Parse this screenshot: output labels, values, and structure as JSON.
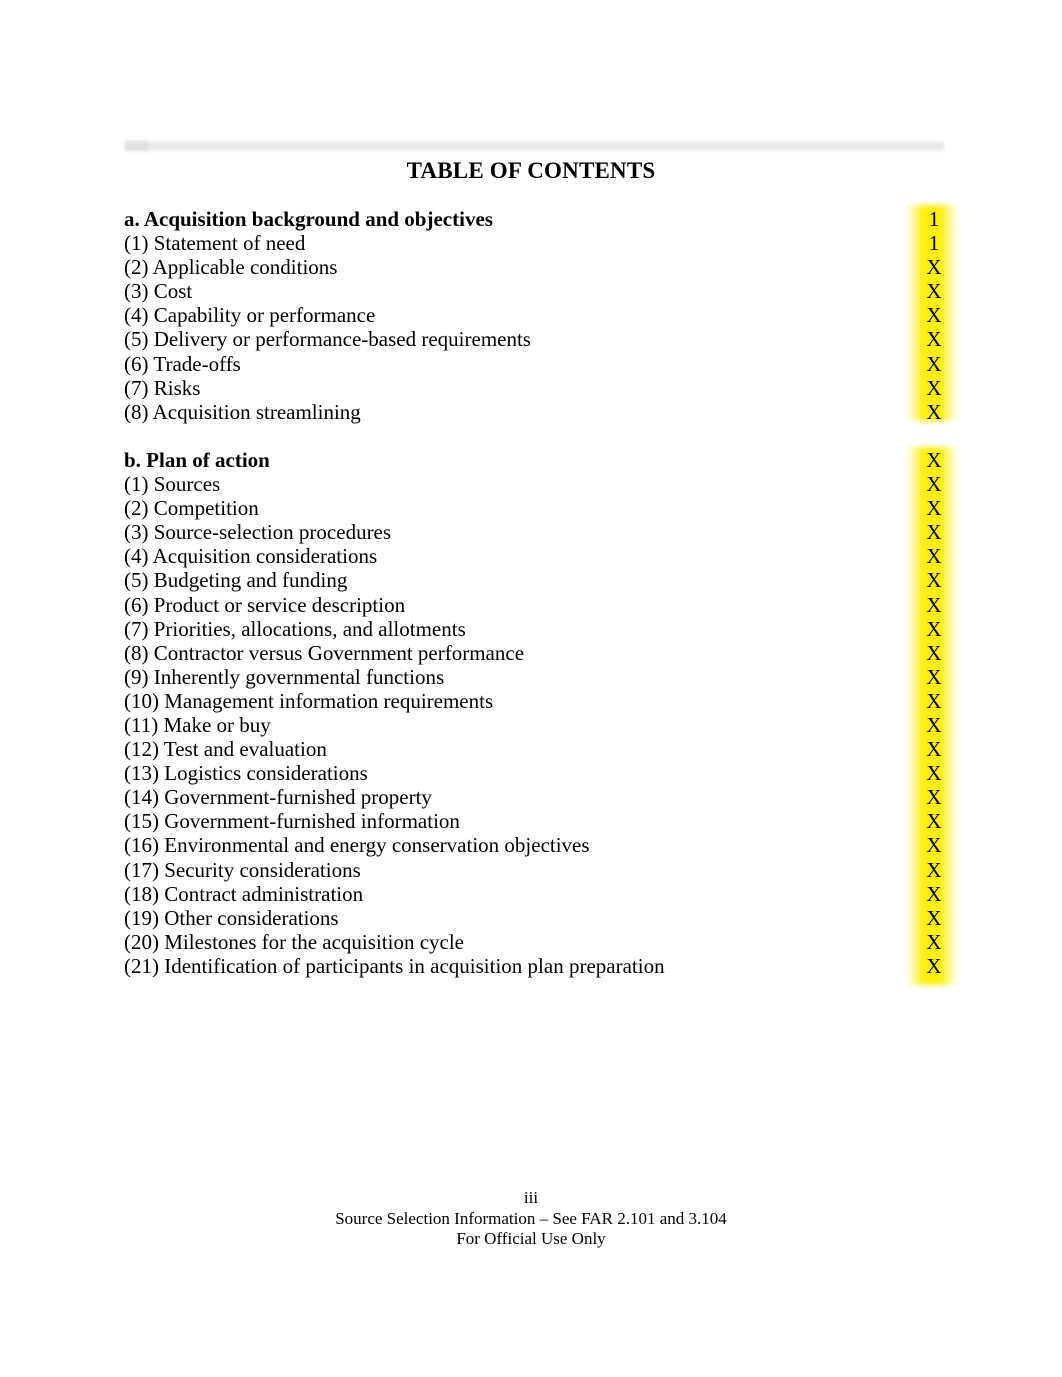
{
  "document": {
    "title": "TABLE OF CONTENTS",
    "header_band_present": true
  },
  "toc": {
    "sections": [
      {
        "heading": {
          "label": "a. Acquisition background and objectives",
          "page": "1"
        },
        "entries": [
          {
            "label": "(1) Statement of need",
            "page": "1"
          },
          {
            "label": "(2) Applicable conditions",
            "page": "X"
          },
          {
            "label": "(3) Cost",
            "page": "X"
          },
          {
            "label": "(4) Capability or performance",
            "page": "X"
          },
          {
            "label": "(5) Delivery or performance-based requirements",
            "page": "X"
          },
          {
            "label": "(6) Trade-offs",
            "page": "X"
          },
          {
            "label": "(7) Risks",
            "page": "X"
          },
          {
            "label": "(8) Acquisition streamlining",
            "page": "X"
          }
        ]
      },
      {
        "heading": {
          "label": "b. Plan of action",
          "page": "X"
        },
        "entries": [
          {
            "label": "(1) Sources",
            "page": "X"
          },
          {
            "label": "(2) Competition",
            "page": "X"
          },
          {
            "label": "(3) Source-selection procedures",
            "page": "X"
          },
          {
            "label": "(4) Acquisition considerations",
            "page": "X"
          },
          {
            "label": "(5) Budgeting and funding",
            "page": "X"
          },
          {
            "label": "(6) Product or service description",
            "page": "X"
          },
          {
            "label": "(7) Priorities, allocations, and allotments",
            "page": "X"
          },
          {
            "label": "(8) Contractor versus Government performance",
            "page": "X"
          },
          {
            "label": "(9) Inherently governmental functions",
            "page": "X"
          },
          {
            "label": "(10) Management information requirements",
            "page": "X"
          },
          {
            "label": "(11) Make or buy",
            "page": "X"
          },
          {
            "label": "(12) Test and evaluation",
            "page": "X"
          },
          {
            "label": "(13) Logistics considerations",
            "page": "X"
          },
          {
            "label": "(14) Government-furnished property",
            "page": "X"
          },
          {
            "label": "(15) Government-furnished information",
            "page": "X"
          },
          {
            "label": "(16) Environmental and energy conservation objectives",
            "page": "X"
          },
          {
            "label": "(17) Security considerations",
            "page": "X"
          },
          {
            "label": "(18) Contract administration",
            "page": "X"
          },
          {
            "label": "(19) Other considerations",
            "page": "X"
          },
          {
            "label": "(20) Milestones for the acquisition cycle",
            "page": "X"
          },
          {
            "label": "(21) Identification of participants in acquisition plan preparation",
            "page": "X"
          }
        ]
      }
    ]
  },
  "highlight": {
    "color": "#FFEC00",
    "applies_to": "page-number-column"
  },
  "footer": {
    "page_number": "iii",
    "notice": "Source Selection Information – See FAR 2.101 and 3.104",
    "use_statement": "For Official Use Only"
  }
}
